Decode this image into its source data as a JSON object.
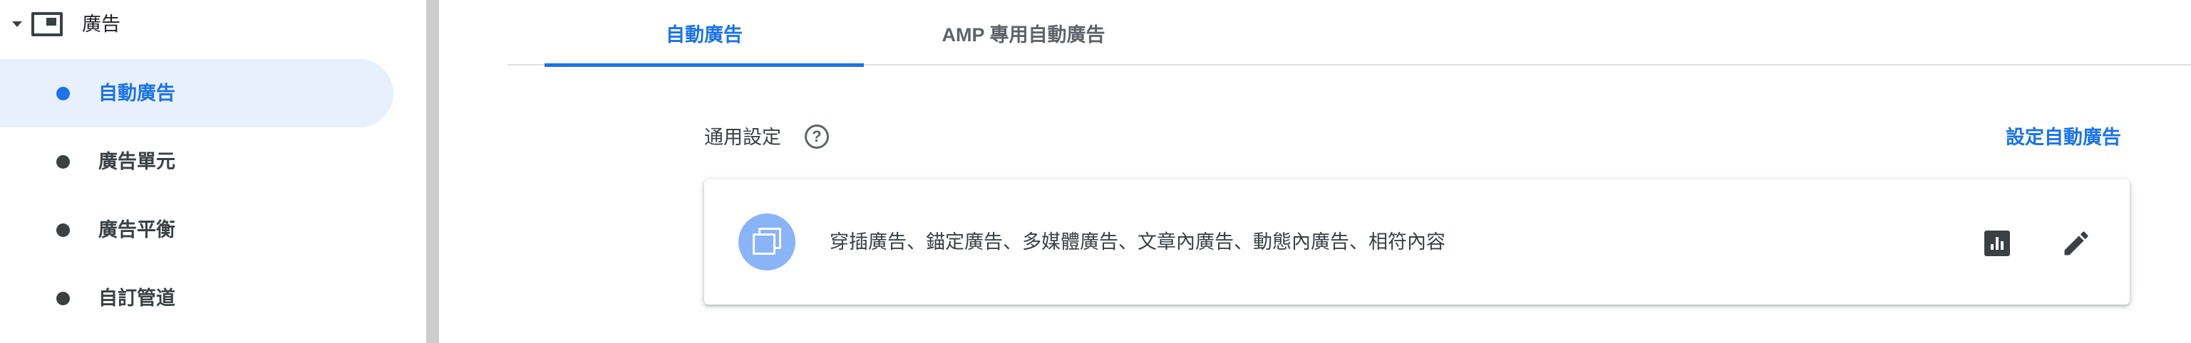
{
  "sidebar": {
    "section_title": "廣告",
    "items": [
      {
        "label": "自動廣告",
        "active": true
      },
      {
        "label": "廣告單元",
        "active": false
      },
      {
        "label": "廣告平衡",
        "active": false
      },
      {
        "label": "自訂管道",
        "active": false
      }
    ]
  },
  "tabs": [
    {
      "label": "自動廣告",
      "active": true
    },
    {
      "label": "AMP 專用自動廣告",
      "active": false
    }
  ],
  "settings": {
    "label": "通用設定",
    "help_glyph": "?",
    "setup_link": "設定自動廣告"
  },
  "card": {
    "formats_text": "穿插廣告、錨定廣告、多媒體廣告、文章內廣告、動態內廣告、相符內容",
    "icon": "multiple-ads-icon"
  },
  "icons": {
    "report": "bar-chart-icon",
    "edit": "edit-pencil-icon",
    "section": "ads-window-icon"
  },
  "colors": {
    "accent": "#1a73e8",
    "active_bg": "#e8f0fe",
    "card_icon_bg": "#8ab4f8",
    "divider": "#cccccc"
  }
}
